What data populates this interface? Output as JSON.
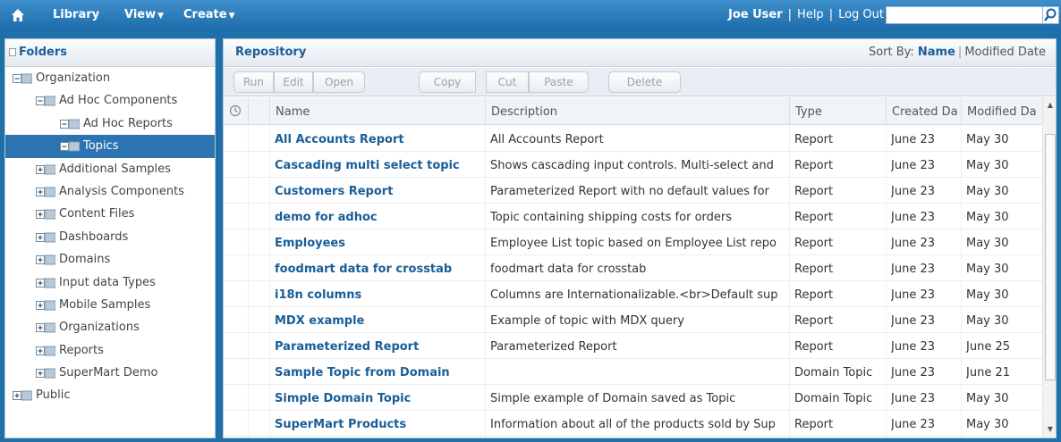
{
  "topbar": {
    "nav": [
      {
        "label": "Library",
        "has_menu": false
      },
      {
        "label": "View",
        "has_menu": true
      },
      {
        "label": "Create",
        "has_menu": true
      }
    ],
    "user": "Joe User",
    "help": "Help",
    "logout": "Log Out",
    "separator": "|",
    "search_value": ""
  },
  "folders": {
    "title": "Folders",
    "tree": [
      {
        "label": "Organization",
        "level": 0,
        "expanded": true,
        "selected": false
      },
      {
        "label": "Ad Hoc Components",
        "level": 1,
        "expanded": true,
        "selected": false
      },
      {
        "label": "Ad Hoc Reports",
        "level": 2,
        "expanded": true,
        "selected": false
      },
      {
        "label": "Topics",
        "level": 2,
        "expanded": true,
        "selected": true
      },
      {
        "label": "Additional Samples",
        "level": 1,
        "expanded": false,
        "selected": false
      },
      {
        "label": "Analysis Components",
        "level": 1,
        "expanded": false,
        "selected": false
      },
      {
        "label": "Content Files",
        "level": 1,
        "expanded": false,
        "selected": false
      },
      {
        "label": "Dashboards",
        "level": 1,
        "expanded": false,
        "selected": false
      },
      {
        "label": "Domains",
        "level": 1,
        "expanded": false,
        "selected": false
      },
      {
        "label": "Input data Types",
        "level": 1,
        "expanded": false,
        "selected": false
      },
      {
        "label": "Mobile Samples",
        "level": 1,
        "expanded": false,
        "selected": false
      },
      {
        "label": "Organizations",
        "level": 1,
        "expanded": false,
        "selected": false
      },
      {
        "label": "Reports",
        "level": 1,
        "expanded": false,
        "selected": false
      },
      {
        "label": "SuperMart Demo",
        "level": 1,
        "expanded": false,
        "selected": false
      },
      {
        "label": "Public",
        "level": 0,
        "expanded": false,
        "selected": false
      }
    ]
  },
  "repository": {
    "title": "Repository",
    "sort_by_label": "Sort By:",
    "sort_options": [
      "Name",
      "Modified Date"
    ],
    "sort_active": "Name",
    "toolbar": [
      "Run",
      "Edit",
      "Open",
      "Copy",
      "Cut",
      "Paste",
      "Delete"
    ],
    "columns": [
      "Name",
      "Description",
      "Type",
      "Created Da",
      "Modified Da"
    ],
    "rows": [
      {
        "name": "All Accounts Report",
        "description": "All Accounts Report",
        "type": "Report",
        "created": "June 23",
        "modified": "May 30"
      },
      {
        "name": "Cascading multi select topic",
        "description": "Shows cascading input controls. Multi-select and",
        "type": "Report",
        "created": "June 23",
        "modified": "May 30"
      },
      {
        "name": "Customers Report",
        "description": "Parameterized Report with no default values for",
        "type": "Report",
        "created": "June 23",
        "modified": "May 30"
      },
      {
        "name": "demo for adhoc",
        "description": "Topic containing shipping costs for orders",
        "type": "Report",
        "created": "June 23",
        "modified": "May 30"
      },
      {
        "name": "Employees",
        "description": "Employee List topic based on Employee List repo",
        "type": "Report",
        "created": "June 23",
        "modified": "May 30"
      },
      {
        "name": "foodmart data for crosstab",
        "description": "foodmart data for crosstab",
        "type": "Report",
        "created": "June 23",
        "modified": "May 30"
      },
      {
        "name": "i18n columns",
        "description": "Columns are Internationalizable.<br>Default sup",
        "type": "Report",
        "created": "June 23",
        "modified": "May 30"
      },
      {
        "name": "MDX example",
        "description": "Example of topic with MDX query",
        "type": "Report",
        "created": "June 23",
        "modified": "May 30"
      },
      {
        "name": "Parameterized Report",
        "description": "Parameterized Report",
        "type": "Report",
        "created": "June 23",
        "modified": "June 25"
      },
      {
        "name": "Sample Topic from Domain",
        "description": "",
        "type": "Domain Topic",
        "created": "June 23",
        "modified": "June 21"
      },
      {
        "name": "Simple Domain Topic",
        "description": "Simple example of Domain saved as Topic",
        "type": "Domain Topic",
        "created": "June 23",
        "modified": "May 30"
      },
      {
        "name": "SuperMart Products",
        "description": "Information about all of the products sold by Sup",
        "type": "Report",
        "created": "June 23",
        "modified": "May 30"
      }
    ]
  },
  "colors": {
    "topbar": "#2a7dbe",
    "accent": "#1a5e98",
    "selected": "#2b74b1"
  }
}
